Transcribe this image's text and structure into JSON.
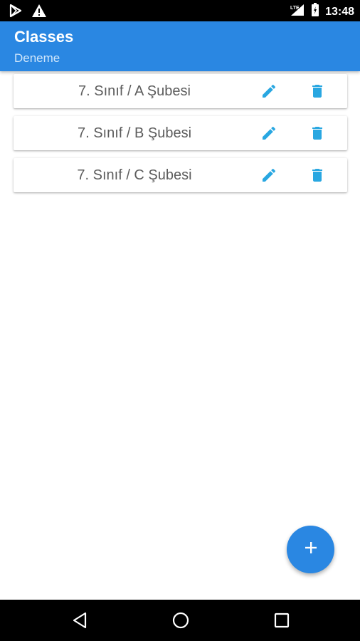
{
  "status_bar": {
    "time": "13:48",
    "left_icons": [
      "play-store-icon",
      "warning-icon"
    ],
    "right_icons": [
      "lte-signal-icon",
      "battery-icon"
    ]
  },
  "app_bar": {
    "title": "Classes",
    "subtitle": "Deneme",
    "color": "#2a87e2"
  },
  "classes": [
    {
      "label": "7. Sınıf / A Şubesi",
      "actions": [
        "edit-icon",
        "delete-icon"
      ]
    },
    {
      "label": "7. Sınıf / B Şubesi",
      "actions": [
        "edit-icon",
        "delete-icon"
      ]
    },
    {
      "label": "7. Sınıf / C Şubesi",
      "actions": [
        "edit-icon",
        "delete-icon"
      ]
    }
  ],
  "accent_color": "#29a7e1",
  "fab": {
    "icon": "plus-icon"
  },
  "nav_bar": {
    "buttons": [
      "back-icon",
      "home-icon",
      "recents-icon"
    ]
  }
}
